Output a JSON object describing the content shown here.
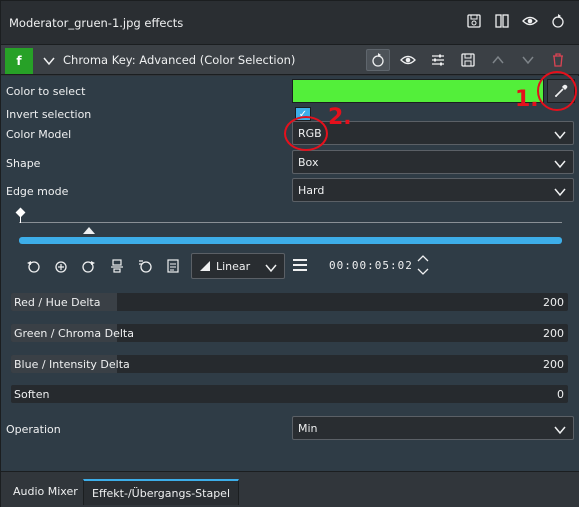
{
  "header": {
    "title": "Moderator_gruen-1.jpg effects",
    "icons": [
      "save-preset-icon",
      "compare-icon",
      "eye-icon",
      "reset-icon"
    ]
  },
  "effect": {
    "badge": "f",
    "name": "Chroma Key: Advanced (Color Selection)",
    "icons": [
      "reset-icon",
      "eye-icon",
      "settings-sliders-icon",
      "save-icon",
      "move-up-icon",
      "move-down-icon",
      "delete-icon"
    ]
  },
  "params": {
    "color_to_select": {
      "label": "Color to select",
      "color": "#53ef3a"
    },
    "invert_selection": {
      "label": "Invert selection",
      "checked": true
    },
    "color_model": {
      "label": "Color Model",
      "value": "RGB"
    },
    "shape": {
      "label": "Shape",
      "value": "Box"
    },
    "edge_mode": {
      "label": "Edge mode",
      "value": "Hard"
    },
    "operation": {
      "label": "Operation",
      "value": "Min"
    }
  },
  "keyframes": {
    "interpolation": "Linear",
    "timecode": "00:00:05:02"
  },
  "sliders": [
    {
      "label": "Red / Hue Delta",
      "value": "200",
      "fill": 0.19
    },
    {
      "label": "Green / Chroma Delta",
      "value": "200",
      "fill": 0.19
    },
    {
      "label": "Blue / Intensity Delta",
      "value": "200",
      "fill": 0.19
    },
    {
      "label": "Soften",
      "value": "0",
      "fill": 0.0
    }
  ],
  "tabs": [
    {
      "label": "Audio Mixer",
      "active": false
    },
    {
      "label": "Effekt-/Übergangs-Stapel",
      "active": true
    }
  ],
  "annotations": {
    "step1": "1.",
    "step2": "2."
  },
  "colors": {
    "accent": "#3daee9",
    "annotation": "#e5101c",
    "badge": "#27a127"
  }
}
